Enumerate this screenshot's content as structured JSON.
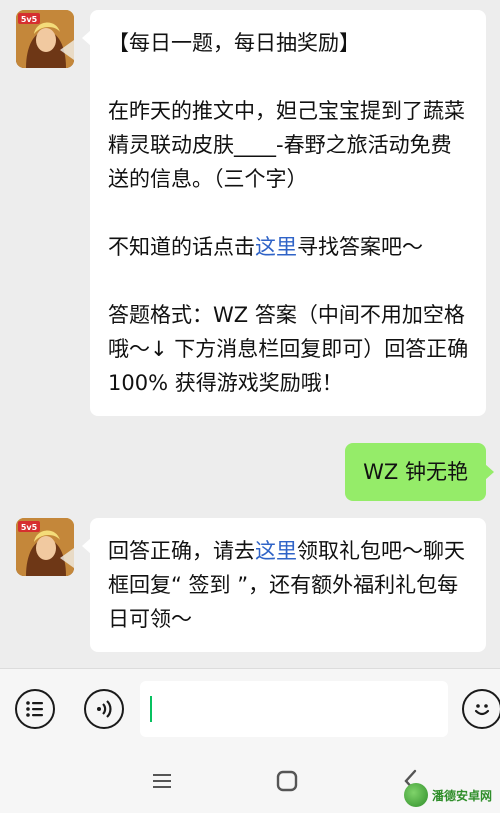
{
  "messages": {
    "question": {
      "title": "【每日一题，每日抽奖励】",
      "line_pre": "在昨天的推文中，妲己宝宝提到了蔬菜精灵联动皮肤____-春野之旅活动免费送的信息。（三个字）",
      "hint_pre": "不知道的话点击",
      "hint_link": "这里",
      "hint_post": "寻找答案吧～",
      "format": "答题格式：WZ 答案（中间不用加空格哦～↓ 下方消息栏回复即可）回答正确 100% 获得游戏奖励哦！"
    },
    "user_reply": "WZ 钟无艳",
    "answer": {
      "pre": "回答正确，请去",
      "link": "这里",
      "post": "领取礼包吧～聊天框回复“ 签到 ”，还有额外福利礼包每日可领～"
    }
  },
  "avatar": {
    "badge": "5v5"
  },
  "input_bar": {
    "menu_icon": "list-icon",
    "voice_icon": "voice-icon",
    "emoji_icon": "emoji-icon",
    "value": ""
  },
  "nav_bar": {
    "menu_icon": "menu-icon",
    "home_icon": "home-icon",
    "back_icon": "back-icon"
  },
  "watermark": {
    "text": "潘德安卓网"
  },
  "colors": {
    "background": "#ededed",
    "incoming_bubble": "#ffffff",
    "outgoing_bubble": "#95ec69",
    "link": "#2f63c7",
    "caret": "#07c160"
  }
}
